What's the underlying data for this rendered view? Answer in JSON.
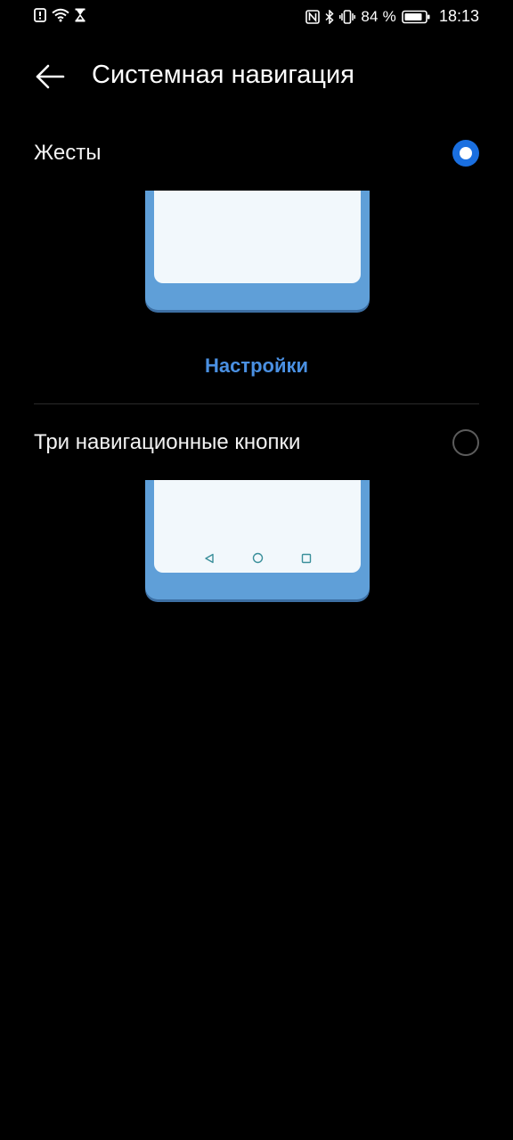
{
  "status_bar": {
    "left_icons": [
      "alert-icon",
      "wifi-icon",
      "hourglass-icon"
    ],
    "right_icons": [
      "nfc-icon",
      "bluetooth-icon",
      "vibrate-icon",
      "battery-icon"
    ],
    "battery_percent": "84 %",
    "time": "18:13"
  },
  "app_bar": {
    "back_icon": "arrow-left-icon",
    "title": "Системная навигация"
  },
  "options": [
    {
      "label": "Жесты",
      "selected": true
    },
    {
      "label": "Три навигационные кнопки",
      "selected": false
    }
  ],
  "gestures_settings_link": "Настройки",
  "colors": {
    "accent": "#1a6fe0",
    "link": "#4a90e2",
    "phone_frame": "#5f9fd8",
    "phone_screen": "#f2f8fc",
    "background": "#000000"
  }
}
